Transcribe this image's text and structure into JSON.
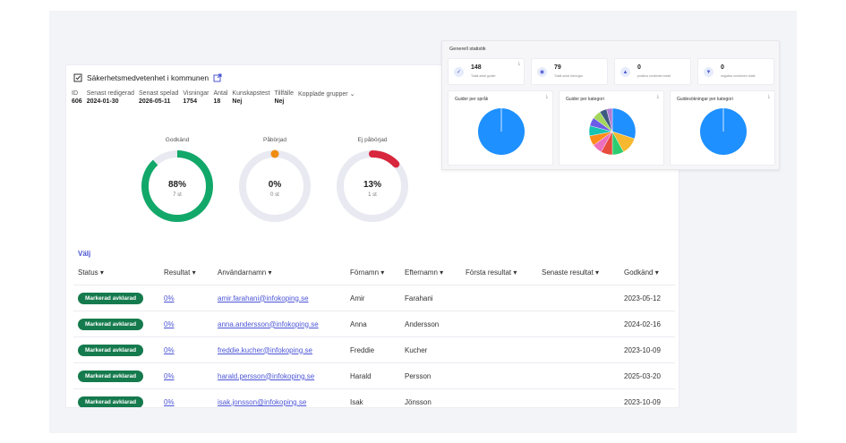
{
  "header": {
    "title": "Säkerhetsmedvetenhet i kommunen",
    "meta": [
      {
        "label": "ID",
        "value": "606"
      },
      {
        "label": "Senast redigerad",
        "value": "2024-01-30"
      },
      {
        "label": "Senast spelad",
        "value": "2026-05-11"
      },
      {
        "label": "Visningar",
        "value": "1754"
      },
      {
        "label": "Antal",
        "value": "18"
      },
      {
        "label": "Kunskapstest",
        "value": "Nej"
      },
      {
        "label": "Tillfälle",
        "value": "Nej"
      },
      {
        "label": "Kopplade grupper",
        "value": ""
      }
    ]
  },
  "donuts": [
    {
      "label": "Godkänd",
      "pct": "88%",
      "count": "7 st",
      "fraction": 0.88,
      "color": "#12a86a"
    },
    {
      "label": "Påbörjad",
      "pct": "0%",
      "count": "0 st",
      "fraction": 0.0,
      "color": "#ef8c12"
    },
    {
      "label": "Ej påbörjad",
      "pct": "13%",
      "count": "1 st",
      "fraction": 0.13,
      "color": "#d7263d"
    }
  ],
  "table": {
    "select_label": "Välj",
    "columns": [
      "Status",
      "Resultat",
      "Användarnamn",
      "Förnamn",
      "Efternamn",
      "Första resultat",
      "Senaste resultat",
      "Godkänd"
    ],
    "rows": [
      {
        "status": "Markerad avklarad",
        "result": "0%",
        "user": "amir.farahani@infokoping.se",
        "first": "Amir",
        "last": "Farahani",
        "first_res": "",
        "latest_res": "",
        "approved": "2023-05-12"
      },
      {
        "status": "Markerad avklarad",
        "result": "0%",
        "user": "anna.andersson@infokoping.se",
        "first": "Anna",
        "last": "Andersson",
        "first_res": "",
        "latest_res": "",
        "approved": "2024-02-16"
      },
      {
        "status": "Markerad avklarad",
        "result": "0%",
        "user": "freddie.kucher@infokoping.se",
        "first": "Freddie",
        "last": "Kucher",
        "first_res": "",
        "latest_res": "",
        "approved": "2023-10-09"
      },
      {
        "status": "Markerad avklarad",
        "result": "0%",
        "user": "harald.persson@infokoping.se",
        "first": "Harald",
        "last": "Persson",
        "first_res": "",
        "latest_res": "",
        "approved": "2025-03-20"
      },
      {
        "status": "Markerad avklarad",
        "result": "0%",
        "user": "isak.jonsson@infokoping.se",
        "first": "Isak",
        "last": "Jönsson",
        "first_res": "",
        "latest_res": "",
        "approved": "2023-10-09"
      }
    ]
  },
  "stats": {
    "title": "Generell statistik",
    "kpis": [
      {
        "value": "148",
        "label": "Totalt antal guider",
        "icon": "check-icon"
      },
      {
        "value": "79",
        "label": "Totalt antal visningar",
        "icon": "eye-icon"
      },
      {
        "value": "0",
        "label": "positiva omdömen totalt",
        "icon": "thumbs-up-icon"
      },
      {
        "value": "0",
        "label": "negativa omdömen totalt",
        "icon": "thumbs-down-icon"
      }
    ],
    "charts": [
      {
        "title": "Guider per språk"
      },
      {
        "title": "Guider per kategori"
      },
      {
        "title": "Guidesökningar per kategori"
      }
    ],
    "category_pie_colors": [
      "#1e90ff",
      "#f5b82e",
      "#2ecc71",
      "#e74c3c",
      "#ec6fbe",
      "#ff8c1a",
      "#17c3b2",
      "#6c5ce7",
      "#a3d65c",
      "#3d5a80",
      "#b07cd6"
    ]
  }
}
